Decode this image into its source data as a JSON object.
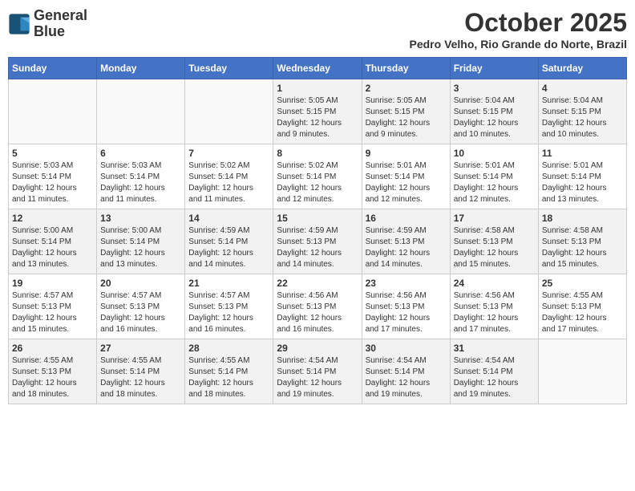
{
  "header": {
    "logo_line1": "General",
    "logo_line2": "Blue",
    "month": "October 2025",
    "location": "Pedro Velho, Rio Grande do Norte, Brazil"
  },
  "days_of_week": [
    "Sunday",
    "Monday",
    "Tuesday",
    "Wednesday",
    "Thursday",
    "Friday",
    "Saturday"
  ],
  "weeks": [
    [
      {
        "day": "",
        "info": ""
      },
      {
        "day": "",
        "info": ""
      },
      {
        "day": "",
        "info": ""
      },
      {
        "day": "1",
        "info": "Sunrise: 5:05 AM\nSunset: 5:15 PM\nDaylight: 12 hours\nand 9 minutes."
      },
      {
        "day": "2",
        "info": "Sunrise: 5:05 AM\nSunset: 5:15 PM\nDaylight: 12 hours\nand 9 minutes."
      },
      {
        "day": "3",
        "info": "Sunrise: 5:04 AM\nSunset: 5:15 PM\nDaylight: 12 hours\nand 10 minutes."
      },
      {
        "day": "4",
        "info": "Sunrise: 5:04 AM\nSunset: 5:15 PM\nDaylight: 12 hours\nand 10 minutes."
      }
    ],
    [
      {
        "day": "5",
        "info": "Sunrise: 5:03 AM\nSunset: 5:14 PM\nDaylight: 12 hours\nand 11 minutes."
      },
      {
        "day": "6",
        "info": "Sunrise: 5:03 AM\nSunset: 5:14 PM\nDaylight: 12 hours\nand 11 minutes."
      },
      {
        "day": "7",
        "info": "Sunrise: 5:02 AM\nSunset: 5:14 PM\nDaylight: 12 hours\nand 11 minutes."
      },
      {
        "day": "8",
        "info": "Sunrise: 5:02 AM\nSunset: 5:14 PM\nDaylight: 12 hours\nand 12 minutes."
      },
      {
        "day": "9",
        "info": "Sunrise: 5:01 AM\nSunset: 5:14 PM\nDaylight: 12 hours\nand 12 minutes."
      },
      {
        "day": "10",
        "info": "Sunrise: 5:01 AM\nSunset: 5:14 PM\nDaylight: 12 hours\nand 12 minutes."
      },
      {
        "day": "11",
        "info": "Sunrise: 5:01 AM\nSunset: 5:14 PM\nDaylight: 12 hours\nand 13 minutes."
      }
    ],
    [
      {
        "day": "12",
        "info": "Sunrise: 5:00 AM\nSunset: 5:14 PM\nDaylight: 12 hours\nand 13 minutes."
      },
      {
        "day": "13",
        "info": "Sunrise: 5:00 AM\nSunset: 5:14 PM\nDaylight: 12 hours\nand 13 minutes."
      },
      {
        "day": "14",
        "info": "Sunrise: 4:59 AM\nSunset: 5:14 PM\nDaylight: 12 hours\nand 14 minutes."
      },
      {
        "day": "15",
        "info": "Sunrise: 4:59 AM\nSunset: 5:13 PM\nDaylight: 12 hours\nand 14 minutes."
      },
      {
        "day": "16",
        "info": "Sunrise: 4:59 AM\nSunset: 5:13 PM\nDaylight: 12 hours\nand 14 minutes."
      },
      {
        "day": "17",
        "info": "Sunrise: 4:58 AM\nSunset: 5:13 PM\nDaylight: 12 hours\nand 15 minutes."
      },
      {
        "day": "18",
        "info": "Sunrise: 4:58 AM\nSunset: 5:13 PM\nDaylight: 12 hours\nand 15 minutes."
      }
    ],
    [
      {
        "day": "19",
        "info": "Sunrise: 4:57 AM\nSunset: 5:13 PM\nDaylight: 12 hours\nand 15 minutes."
      },
      {
        "day": "20",
        "info": "Sunrise: 4:57 AM\nSunset: 5:13 PM\nDaylight: 12 hours\nand 16 minutes."
      },
      {
        "day": "21",
        "info": "Sunrise: 4:57 AM\nSunset: 5:13 PM\nDaylight: 12 hours\nand 16 minutes."
      },
      {
        "day": "22",
        "info": "Sunrise: 4:56 AM\nSunset: 5:13 PM\nDaylight: 12 hours\nand 16 minutes."
      },
      {
        "day": "23",
        "info": "Sunrise: 4:56 AM\nSunset: 5:13 PM\nDaylight: 12 hours\nand 17 minutes."
      },
      {
        "day": "24",
        "info": "Sunrise: 4:56 AM\nSunset: 5:13 PM\nDaylight: 12 hours\nand 17 minutes."
      },
      {
        "day": "25",
        "info": "Sunrise: 4:55 AM\nSunset: 5:13 PM\nDaylight: 12 hours\nand 17 minutes."
      }
    ],
    [
      {
        "day": "26",
        "info": "Sunrise: 4:55 AM\nSunset: 5:13 PM\nDaylight: 12 hours\nand 18 minutes."
      },
      {
        "day": "27",
        "info": "Sunrise: 4:55 AM\nSunset: 5:14 PM\nDaylight: 12 hours\nand 18 minutes."
      },
      {
        "day": "28",
        "info": "Sunrise: 4:55 AM\nSunset: 5:14 PM\nDaylight: 12 hours\nand 18 minutes."
      },
      {
        "day": "29",
        "info": "Sunrise: 4:54 AM\nSunset: 5:14 PM\nDaylight: 12 hours\nand 19 minutes."
      },
      {
        "day": "30",
        "info": "Sunrise: 4:54 AM\nSunset: 5:14 PM\nDaylight: 12 hours\nand 19 minutes."
      },
      {
        "day": "31",
        "info": "Sunrise: 4:54 AM\nSunset: 5:14 PM\nDaylight: 12 hours\nand 19 minutes."
      },
      {
        "day": "",
        "info": ""
      }
    ]
  ]
}
